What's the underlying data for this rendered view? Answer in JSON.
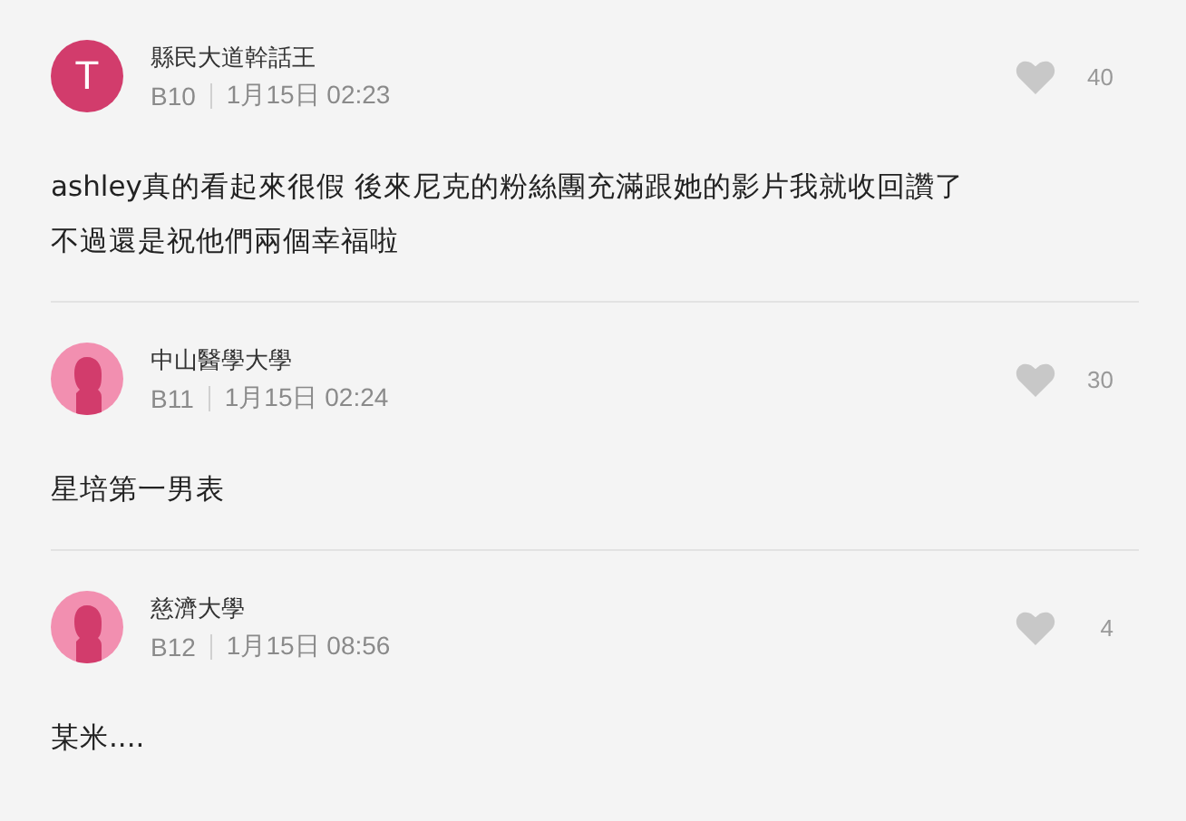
{
  "comments": [
    {
      "avatar": {
        "kind": "letter",
        "text": "T"
      },
      "author": "縣民大道幹話王",
      "floor": "B10",
      "time": "1月15日 02:23",
      "likes": "40",
      "lines": [
        "ashley真的看起來很假 後來尼克的粉絲團充滿跟她的影片我就收回讚了",
        "不過還是祝他們兩個幸福啦"
      ]
    },
    {
      "avatar": {
        "kind": "female"
      },
      "author": "中山醫學大學",
      "floor": "B11",
      "time": "1月15日 02:24",
      "likes": "30",
      "lines": [
        "星培第一男表"
      ]
    },
    {
      "avatar": {
        "kind": "female"
      },
      "author": "慈濟大學",
      "floor": "B12",
      "time": "1月15日 08:56",
      "likes": "4",
      "lines": [
        "某米...."
      ]
    }
  ]
}
